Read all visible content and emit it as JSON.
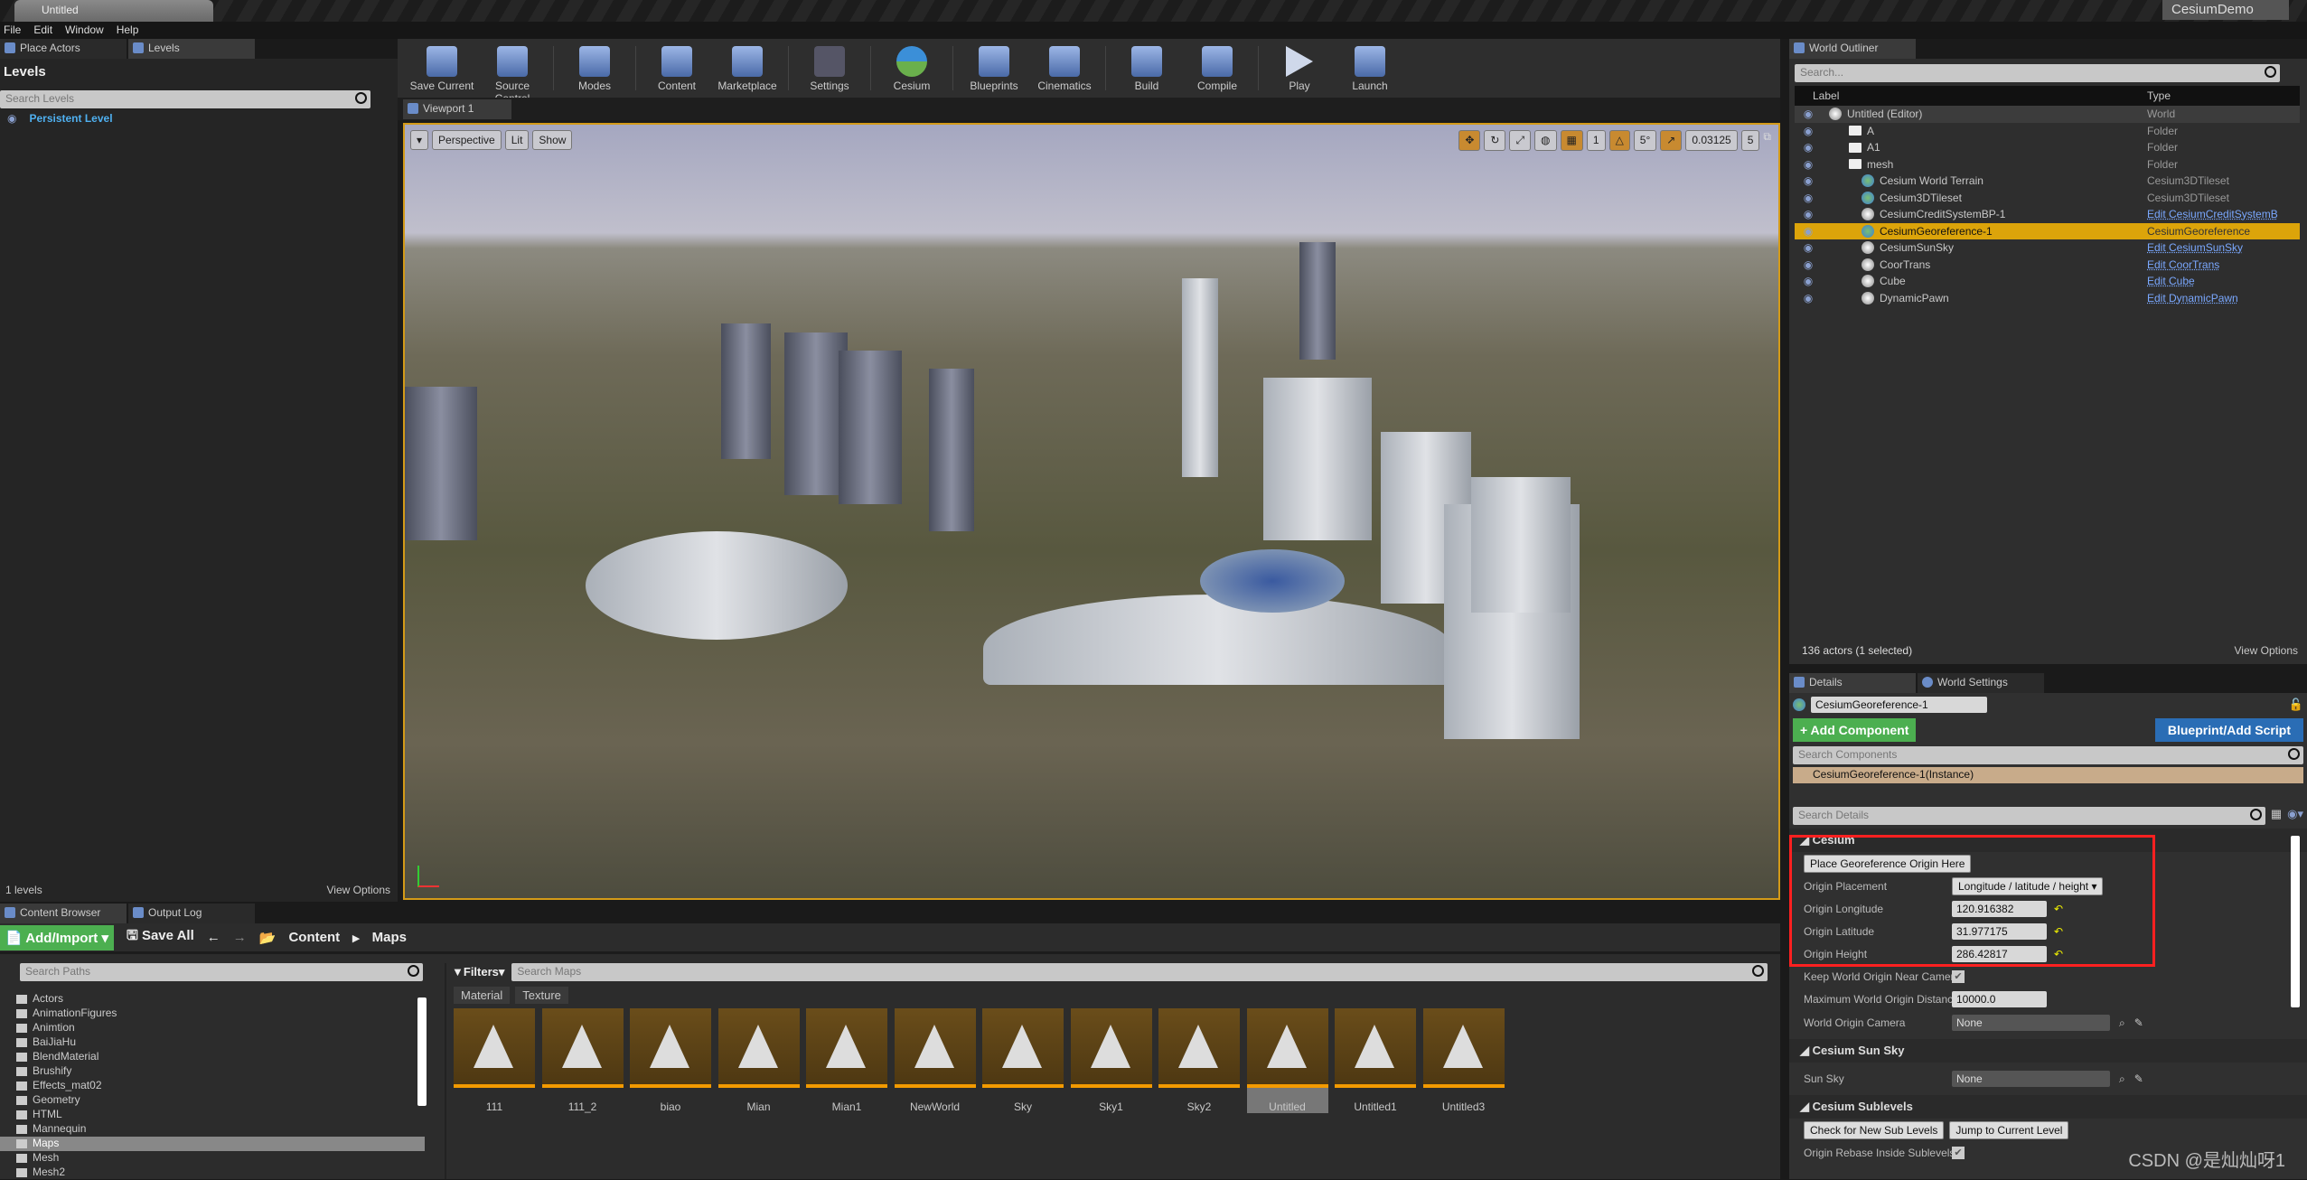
{
  "window": {
    "tab_title": "Untitled",
    "project": "CesiumDemo"
  },
  "menu": [
    "File",
    "Edit",
    "Window",
    "Help"
  ],
  "left_panel": {
    "tabs": [
      "Place Actors",
      "Levels"
    ],
    "heading": "Levels",
    "search_placeholder": "Search Levels",
    "levels": [
      "Persistent Level"
    ],
    "count": "1 levels",
    "view_options": "View Options"
  },
  "toolbar": {
    "buttons": [
      "Save Current",
      "Source Control",
      "Modes",
      "Content",
      "Marketplace",
      "Settings",
      "Cesium",
      "Blueprints",
      "Cinematics",
      "Build",
      "Compile",
      "Play",
      "Launch"
    ]
  },
  "viewport": {
    "tab": "Viewport 1",
    "view_mode": "Perspective",
    "lighting": "Lit",
    "show": "Show",
    "grid_snap": "1",
    "rotation_snap": "5°",
    "scale_snap": "0.03125",
    "camera_speed": "5"
  },
  "outliner": {
    "tab": "World Outliner",
    "search_placeholder": "Search...",
    "col_label": "Label",
    "col_type": "Type",
    "rows": [
      {
        "label": "Untitled (Editor)",
        "type": "World",
        "icon": "world"
      },
      {
        "label": "A",
        "type": "Folder",
        "icon": "folder"
      },
      {
        "label": "A1",
        "type": "Folder",
        "icon": "folder"
      },
      {
        "label": "mesh",
        "type": "Folder",
        "icon": "folder"
      },
      {
        "label": "Cesium World Terrain",
        "type": "Cesium3DTileset",
        "icon": "cesium"
      },
      {
        "label": "Cesium3DTileset",
        "type": "Cesium3DTileset",
        "icon": "cesium"
      },
      {
        "label": "CesiumCreditSystemBP-1",
        "type": "Edit CesiumCreditSystemB",
        "icon": "blueprint",
        "link": true
      },
      {
        "label": "CesiumGeoreference-1",
        "type": "CesiumGeoreference",
        "icon": "cesium",
        "selected": true
      },
      {
        "label": "CesiumSunSky",
        "type": "Edit CesiumSunSky",
        "icon": "blueprint",
        "link": true
      },
      {
        "label": "CoorTrans",
        "type": "Edit CoorTrans",
        "icon": "blueprint",
        "link": true
      },
      {
        "label": "Cube",
        "type": "Edit Cube",
        "icon": "blueprint",
        "link": true
      },
      {
        "label": "DynamicPawn",
        "type": "Edit DynamicPawn",
        "icon": "pawn",
        "link": true
      }
    ],
    "status": "136 actors (1 selected)",
    "view_options": "View Options"
  },
  "details": {
    "tabs": [
      "Details",
      "World Settings"
    ],
    "actor_name": "CesiumGeoreference-1",
    "add_component": "+ Add Component",
    "blueprint": "Blueprint/Add Script",
    "search_components": "Search Components",
    "instance": "CesiumGeoreference-1(Instance)",
    "search_details": "Search Details",
    "cesium": {
      "title": "Cesium",
      "place_button": "Place Georeference Origin Here",
      "origin_placement_label": "Origin Placement",
      "origin_placement": "Longitude / latitude / height",
      "lon_label": "Origin Longitude",
      "lon": "120.916382",
      "lat_label": "Origin Latitude",
      "lat": "31.977175",
      "height_label": "Origin Height",
      "height": "286.42817",
      "keep_label": "Keep World Origin Near Camera",
      "keep": true,
      "maxdist_label": "Maximum World Origin Distance fro",
      "maxdist": "10000.0",
      "camera_label": "World Origin Camera",
      "camera": "None"
    },
    "sunsky": {
      "title": "Cesium Sun Sky",
      "label": "Sun Sky",
      "value": "None"
    },
    "sublevels": {
      "title": "Cesium Sublevels",
      "check": "Check for New Sub Levels",
      "jump": "Jump to Current Level",
      "rebase_label": "Origin Rebase Inside Sublevels",
      "rebase": true
    }
  },
  "content_browser": {
    "tabs": [
      "Content Browser",
      "Output Log"
    ],
    "add_import": "Add/Import",
    "save_all": "Save All",
    "path": [
      "Content",
      "Maps"
    ],
    "search_paths": "Search Paths",
    "filters": "Filters",
    "search_maps": "Search Maps",
    "filter_chips": [
      "Material",
      "Texture"
    ],
    "folders": [
      "Actors",
      "AnimationFigures",
      "Animtion",
      "BaiJiaHu",
      "BlendMaterial",
      "Brushify",
      "Effects_mat02",
      "Geometry",
      "HTML",
      "Mannequin",
      "Maps",
      "Mesh",
      "Mesh2"
    ],
    "assets": [
      "111",
      "111_2",
      "biao",
      "Mian",
      "Mian1",
      "NewWorld",
      "Sky",
      "Sky1",
      "Sky2",
      "Untitled",
      "Untitled1",
      "Untitled3"
    ],
    "selected_asset": "Untitled"
  },
  "watermark": "CSDN @是灿灿呀1",
  "colors": {
    "selection": "#dca40a",
    "accent_orange": "#f39a00",
    "add_green": "#4caf50",
    "blueprint_blue": "#2a6db5",
    "highlight_box": "#ff2020"
  }
}
